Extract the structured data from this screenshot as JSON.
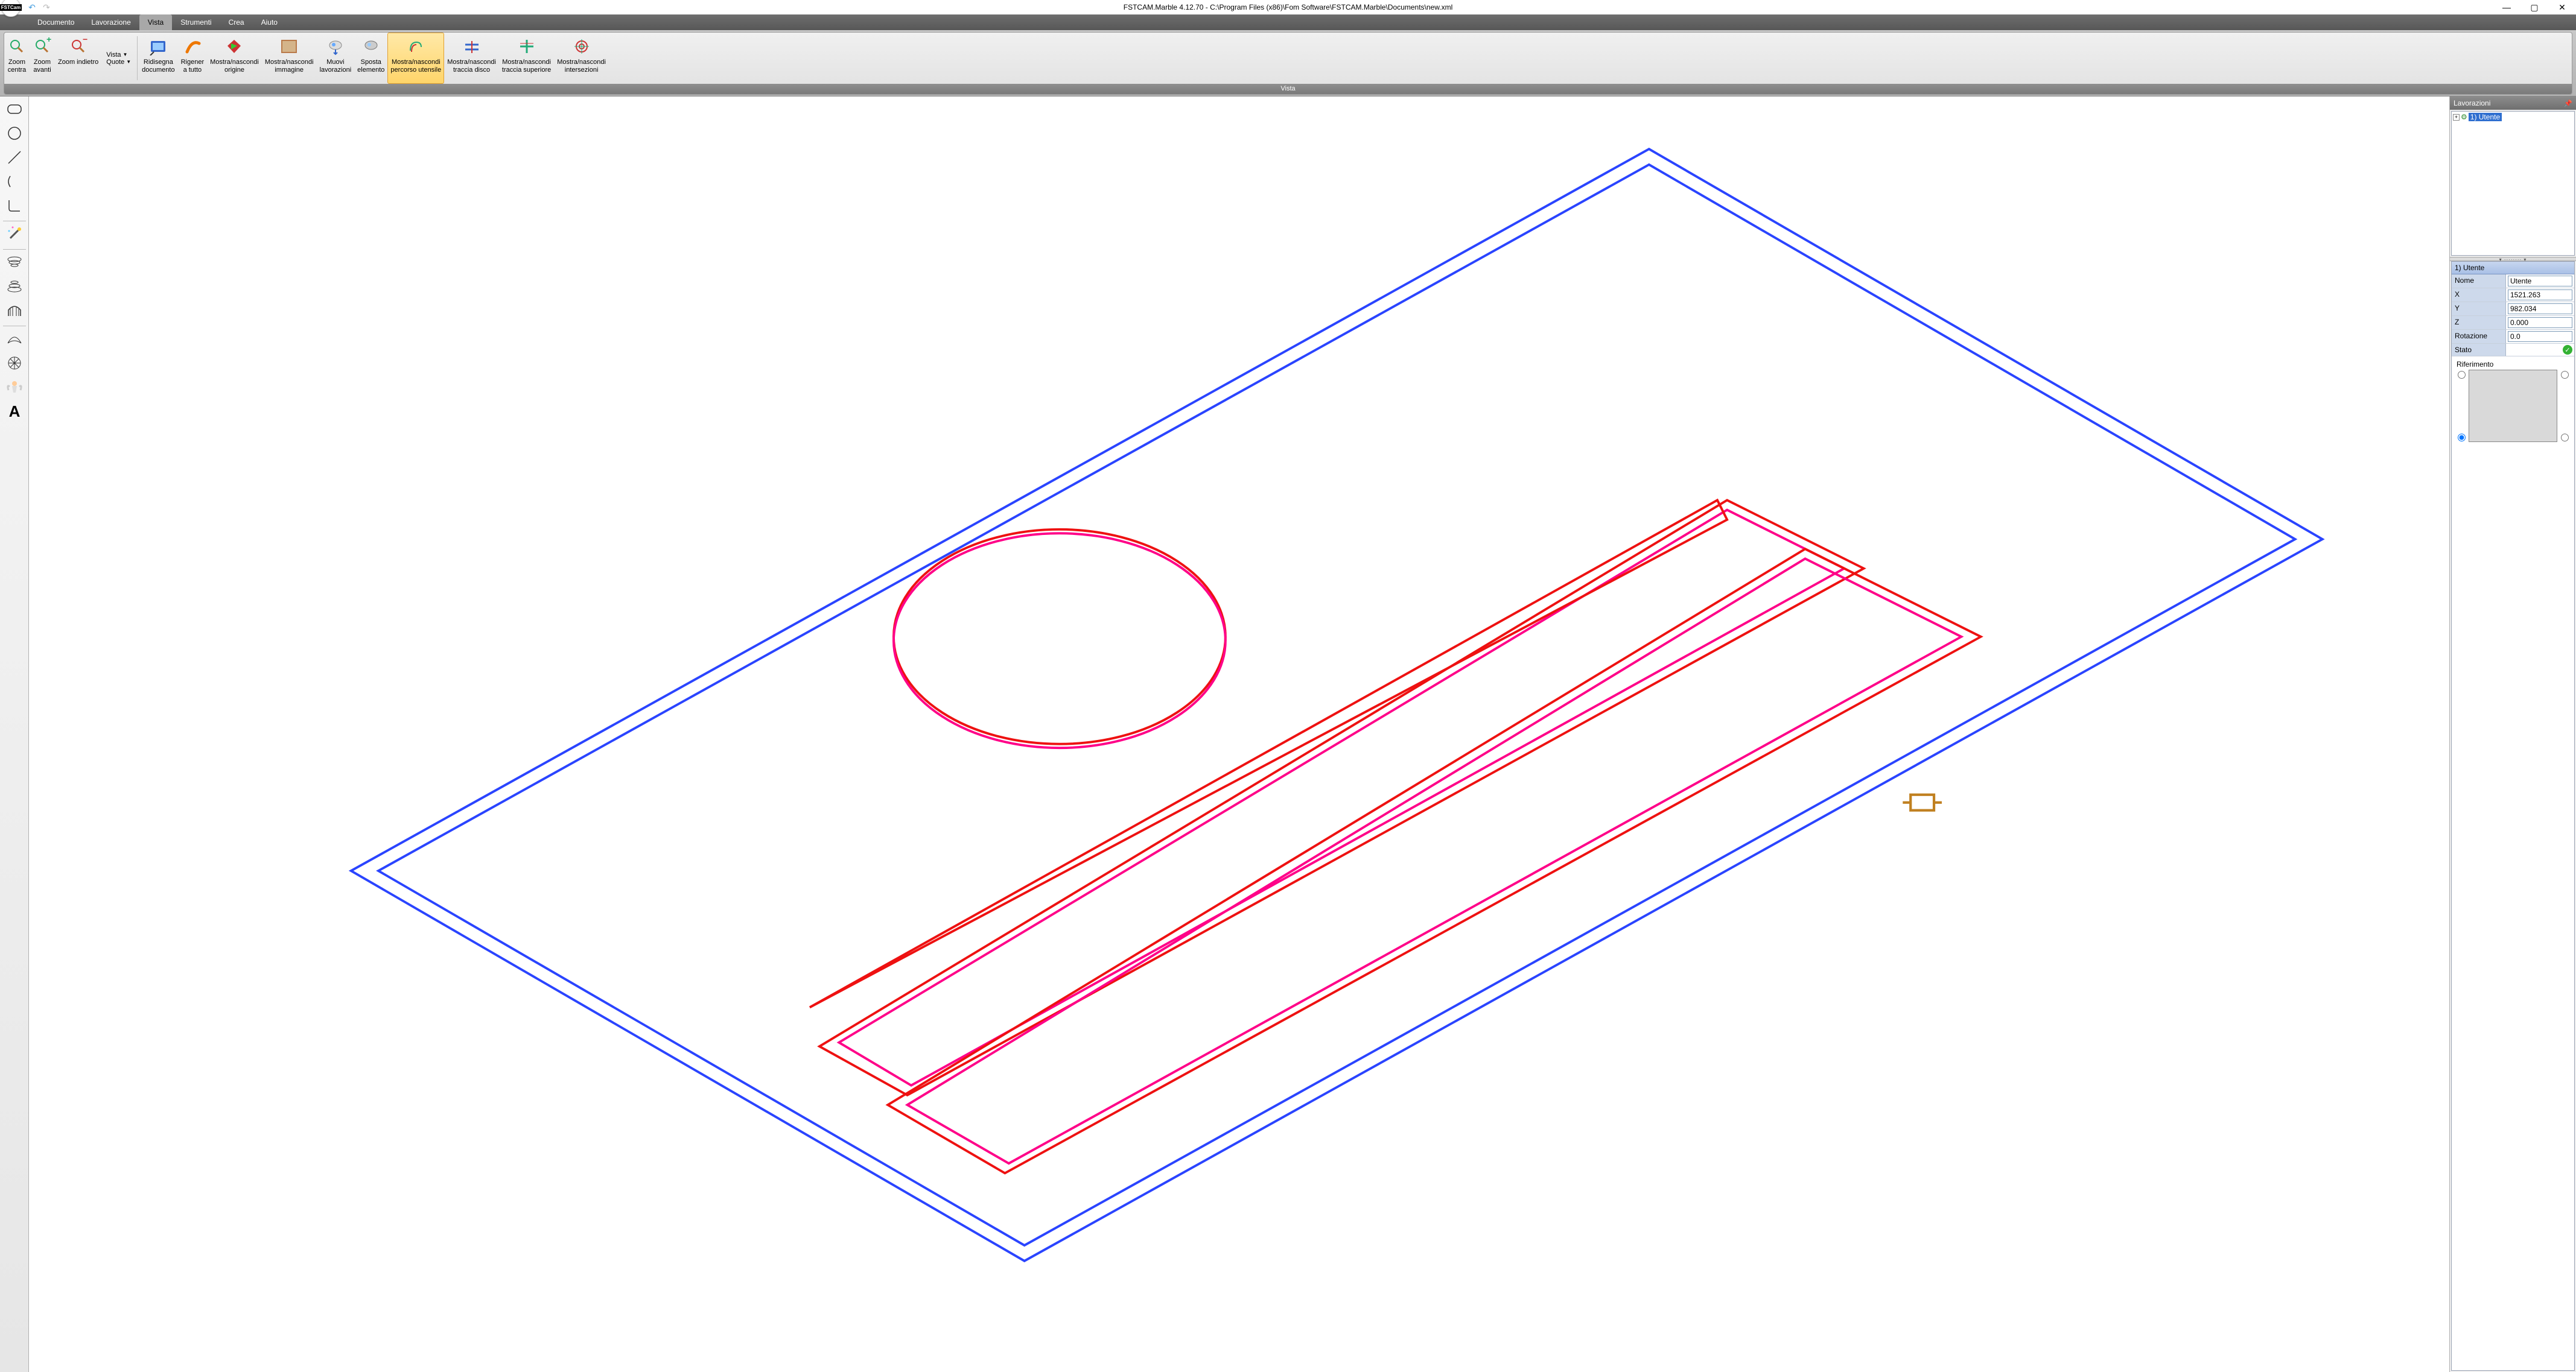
{
  "title": "FSTCAM.Marble 4.12.70 - C:\\Program Files (x86)\\Fom Software\\FSTCAM.Marble\\Documents\\new.xml",
  "app_logo_text": "FSTCam",
  "menus": [
    "Documento",
    "Lavorazione",
    "Vista",
    "Strumenti",
    "Crea",
    "Aiuto"
  ],
  "active_menu_index": 2,
  "ribbon": {
    "group_label": "Vista",
    "buttons": [
      {
        "label": "Zoom\ncentra",
        "icon": "zoom-center-icon"
      },
      {
        "label": "Zoom\navanti",
        "icon": "zoom-in-icon"
      },
      {
        "label": "Zoom indietro",
        "icon": "zoom-out-icon"
      }
    ],
    "dropdowns": [
      "Vista",
      "Quote"
    ],
    "buttons2": [
      {
        "label": "Ridisegna\ndocumento",
        "icon": "redraw-icon"
      },
      {
        "label": "Rigener\na tutto",
        "icon": "regen-icon"
      },
      {
        "label": "Mostra/nascondi\norigine",
        "icon": "origin-icon"
      },
      {
        "label": "Mostra/nascondi\nimmagine",
        "icon": "image-icon"
      },
      {
        "label": "Muovi\nlavorazioni",
        "icon": "move-icon"
      },
      {
        "label": "Sposta\nelemento",
        "icon": "shift-icon"
      },
      {
        "label": "Mostra/nascondi\npercorso utensile",
        "icon": "toolpath-icon",
        "active": true
      },
      {
        "label": "Mostra/nascondi\ntraccia disco",
        "icon": "disctrace-icon"
      },
      {
        "label": "Mostra/nascondi\ntraccia superiore",
        "icon": "toptrace-icon"
      },
      {
        "label": "Mostra/nascondi\nintersezioni",
        "icon": "intersect-icon"
      }
    ]
  },
  "right_panel": {
    "title": "Lavorazioni",
    "tree_node": "1) Utente",
    "prop_title": "1) Utente",
    "rows": {
      "Nome": "Utente",
      "X": "1521.263",
      "Y": "982.034",
      "Z": "0.000",
      "Rotazione": "0.0"
    },
    "stato_label": "Stato",
    "riferimento_label": "Riferimento"
  },
  "tool_icons": [
    "rounded-rect-icon",
    "circle-icon",
    "line-icon",
    "arc-c-icon",
    "corner-icon",
    "sep",
    "wand-icon",
    "sep",
    "spiral1-icon",
    "spiral2-icon",
    "arch-icon",
    "sep",
    "shell-icon",
    "sunburst-icon",
    "angel-icon",
    "text-icon"
  ]
}
